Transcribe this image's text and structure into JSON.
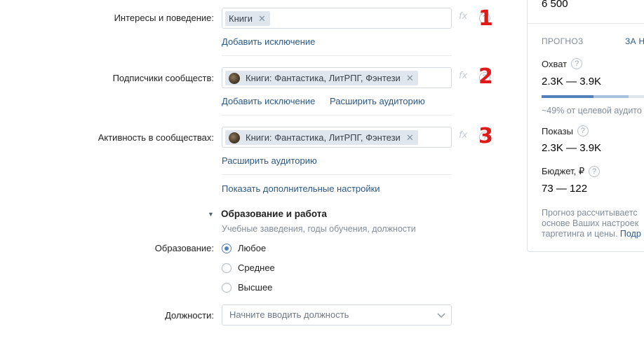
{
  "interests": {
    "label": "Интересы и поведение:",
    "chip": "Книги",
    "add_exclusion": "Добавить исключение",
    "marker": "1"
  },
  "subscribers": {
    "label": "Подписчики сообществ:",
    "chip": "Книги: Фантастика, ЛитРПГ, Фэнтези",
    "add_exclusion": "Добавить исключение",
    "expand": "Расширить аудиторию",
    "marker": "2"
  },
  "activity": {
    "label": "Активность в сообществах:",
    "chip": "Книги: Фантастика, ЛитРПГ, Фэнтези",
    "expand": "Расширить аудиторию",
    "marker": "3"
  },
  "common": {
    "fx": "fx",
    "remove": "✕",
    "help": "?"
  },
  "more_settings": "Показать дополнительные настройки",
  "education_section": {
    "arrow": "▼",
    "title": "Образование и работа",
    "subtitle": "Учебные заведения, годы обучения, должности"
  },
  "education": {
    "label": "Образование:",
    "options": [
      "Любое",
      "Среднее",
      "Высшее"
    ],
    "selected": "Любое"
  },
  "positions": {
    "label": "Должности:",
    "placeholder": "Начните вводить должность"
  },
  "forecast": {
    "top_value": "6 500",
    "heading": "ПРОГНОЗ",
    "tab": "ЗА Н",
    "reach_label": "Охват",
    "reach_value": "2.3K — 3.9K",
    "reach_note": "~49% от целевой аудито",
    "reach_fraction": 0.49,
    "impressions_label": "Показы",
    "impressions_value": "2.3K — 3.9K",
    "budget_label": "Бюджет, ₽",
    "budget_value": "73 — 122",
    "note_line1": "Прогноз рассчитываетс",
    "note_line2": "основе Ваших настроек",
    "note_line3_text": "таргетинга и цены. ",
    "note_line3_link": "Подр"
  },
  "colors": {
    "link": "#2a5885",
    "marker": "#e01919",
    "accent": "#5181b8"
  }
}
